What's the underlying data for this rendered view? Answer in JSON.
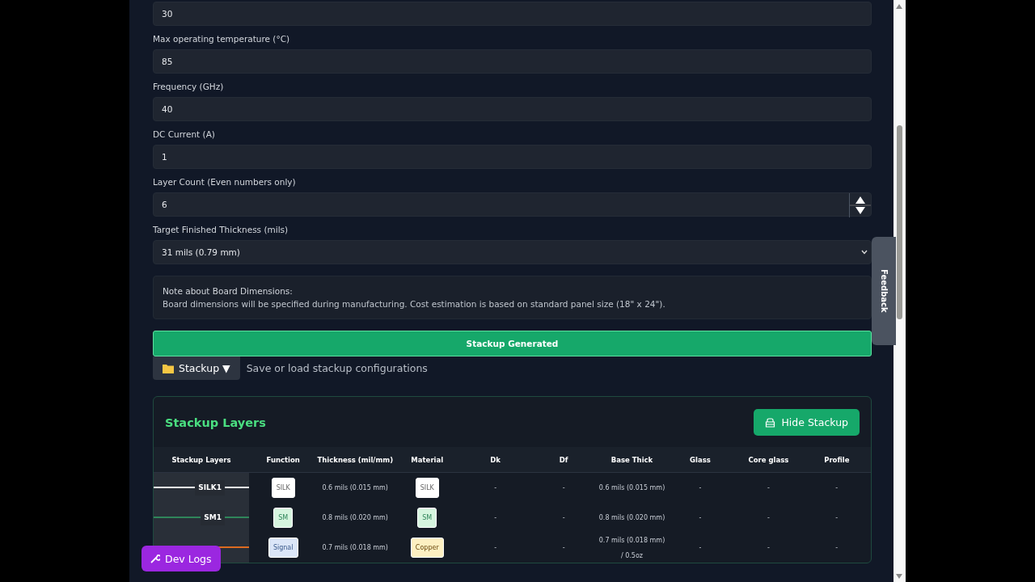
{
  "fields": [
    {
      "kind": "number",
      "value": "30"
    },
    {
      "kind": "number",
      "label": "Max operating temperature (°C)",
      "value": "85"
    },
    {
      "kind": "number",
      "label": "Frequency (GHz)",
      "value": "40"
    },
    {
      "kind": "number",
      "label": "DC Current (A)",
      "value": "1"
    },
    {
      "kind": "spinner",
      "label": "Layer Count (Even numbers only)",
      "value": "6"
    },
    {
      "kind": "select",
      "label": "Target Finished Thickness (mils)",
      "value": "31 mils (0.79 mm)"
    }
  ],
  "note": {
    "title": "Note about Board Dimensions:",
    "text": "Board dimensions will be specified during manufacturing. Cost estimation is based on standard panel size (18\" x 24\")."
  },
  "generate_button": "Stackup Generated",
  "stackup_menu": {
    "label": "Stackup ▼",
    "hint": "Save or load stackup configurations"
  },
  "stackup_card": {
    "title": "Stackup Layers",
    "hide_button": "Hide Stackup",
    "columns": [
      "Stackup Layers",
      "Function",
      "Thickness (mil/mm)",
      "Material",
      "Dk",
      "Df",
      "Base Thick",
      "Glass",
      "Core glass",
      "Profile"
    ],
    "rows": [
      {
        "layer": {
          "name": "SILK1",
          "color": "#f3f4f6"
        },
        "function": {
          "text": "SILK",
          "kind": "silk"
        },
        "thickness": "0.6 mils (0.015 mm)",
        "material": {
          "text": "SILK",
          "kind": "silk"
        },
        "dk": "-",
        "df": "-",
        "base_thick": "0.6 mils (0.015 mm)",
        "glass": "-",
        "core_glass": "-",
        "profile": "-"
      },
      {
        "layer": {
          "name": "SM1",
          "color": "#2f855a"
        },
        "function": {
          "text": "SM",
          "kind": "sm"
        },
        "thickness": "0.8 mils (0.020 mm)",
        "material": {
          "text": "SM",
          "kind": "sm"
        },
        "dk": "-",
        "df": "-",
        "base_thick": "0.8 mils (0.020 mm)",
        "glass": "-",
        "core_glass": "-",
        "profile": "-"
      },
      {
        "layer": {
          "color": "#dd6b20"
        },
        "function": {
          "text": "Signal",
          "kind": "signal"
        },
        "thickness": "0.7 mils (0.018 mm)",
        "material": {
          "text": "Copper",
          "kind": "copper"
        },
        "dk": "-",
        "df": "-",
        "base_thick": "0.7 mils (0.018 mm) / 0.5oz",
        "glass": "-",
        "core_glass": "-",
        "profile": "-"
      }
    ]
  },
  "dev_logs_button": "Dev Logs",
  "feedback_tab": "Feedback"
}
